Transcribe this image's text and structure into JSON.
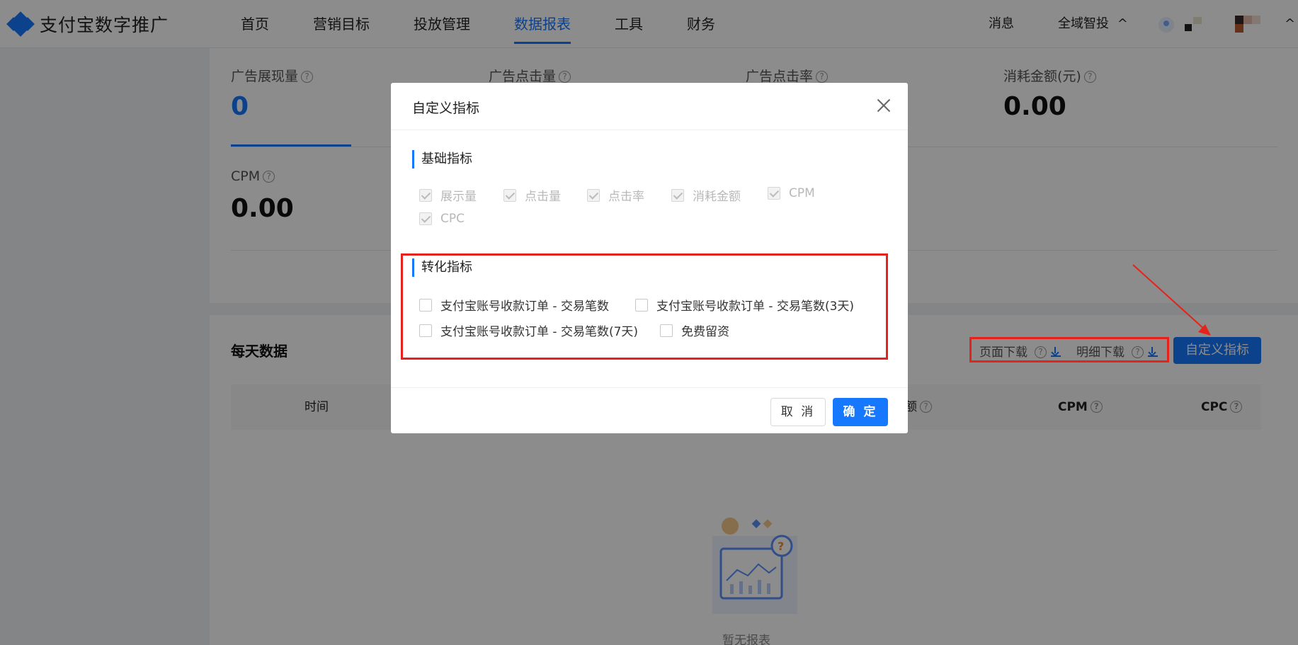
{
  "header": {
    "brand": "支付宝数字推广",
    "nav": [
      "首页",
      "营销目标",
      "投放管理",
      "数据报表",
      "工具",
      "财务"
    ],
    "active_nav": "数据报表",
    "messages": "消息",
    "global": "全域智投"
  },
  "metrics": [
    {
      "label": "广告展现量",
      "value": "0"
    },
    {
      "label": "广告点击量",
      "value": ""
    },
    {
      "label": "广告点击率",
      "value": ""
    },
    {
      "label": "消耗金额(元)",
      "value": "0.00"
    },
    {
      "label": "CPM",
      "value": "0.00"
    }
  ],
  "daily": {
    "title": "每天数据",
    "page_download": "页面下载",
    "detail_download": "明细下载",
    "custom_button": "自定义指标",
    "columns": [
      "时间",
      "额",
      "CPM",
      "CPC"
    ],
    "empty_text": "暂无报表"
  },
  "modal": {
    "title": "自定义指标",
    "basic_group": "基础指标",
    "basic_items": [
      "展示量",
      "点击量",
      "点击率",
      "消耗金额",
      "CPM",
      "CPC"
    ],
    "conversion_group": "转化指标",
    "conversion_items": [
      "支付宝账号收款订单 - 交易笔数",
      "支付宝账号收款订单 - 交易笔数(3天)",
      "支付宝账号收款订单 - 交易笔数(7天)",
      "免费留资"
    ],
    "cancel": "取 消",
    "ok": "确 定"
  },
  "colors": {
    "accent": "#1677ff",
    "annotation": "#e5221b"
  }
}
